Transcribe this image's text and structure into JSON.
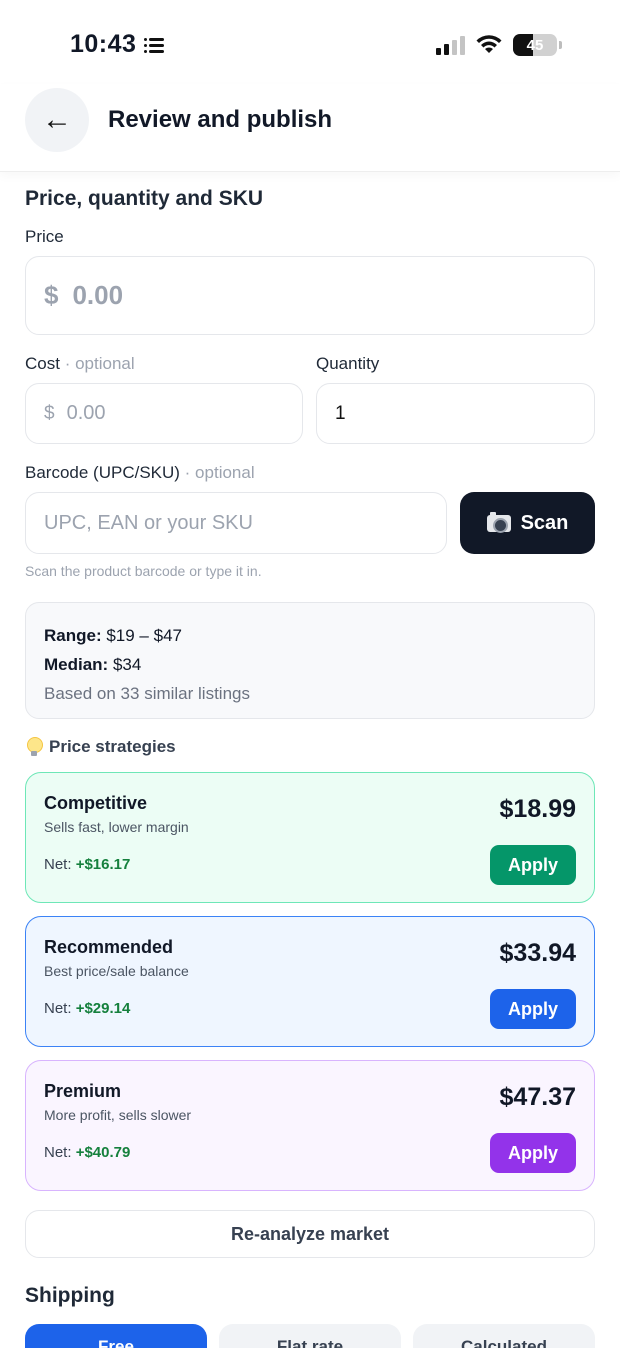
{
  "status_bar": {
    "time": "10:43",
    "battery": "45",
    "battery_level": 0.45
  },
  "header": {
    "back_icon": "←",
    "title": "Review and publish"
  },
  "pricing": {
    "section_title": "Price, quantity and SKU",
    "price_label": "Price",
    "price_currency": "$",
    "price_placeholder": "0.00",
    "cost_label": "Cost",
    "cost_optional": "· optional",
    "cost_currency": "$",
    "cost_placeholder": "0.00",
    "quantity_label": "Quantity",
    "quantity_value": "1",
    "barcode_label": "Barcode (UPC/SKU)",
    "barcode_optional": "· optional",
    "barcode_placeholder": "UPC, EAN or your SKU",
    "scan_label": "Scan",
    "helper": "Scan the product barcode or type it in."
  },
  "market": {
    "range_label": "Range:",
    "range_value": " $19 – $47",
    "median_label": "Median:",
    "median_value": " $34",
    "note": "Based on 33 similar listings"
  },
  "strategies": {
    "title": "Price strategies",
    "items": [
      {
        "name": "Competitive",
        "desc": "Sells fast, lower margin",
        "price": "$18.99",
        "net_label": "Net: ",
        "net_value": "+$16.17",
        "apply": "Apply"
      },
      {
        "name": "Recommended",
        "desc": "Best price/sale balance",
        "price": "$33.94",
        "net_label": "Net: ",
        "net_value": "+$29.14",
        "apply": "Apply"
      },
      {
        "name": "Premium",
        "desc": "More profit, sells slower",
        "price": "$47.37",
        "net_label": "Net: ",
        "net_value": "+$40.79",
        "apply": "Apply"
      }
    ],
    "reanalyze": "Re-analyze market"
  },
  "shipping": {
    "title": "Shipping",
    "tabs": [
      {
        "label": "Free"
      },
      {
        "label": "Flat rate"
      },
      {
        "label": "Calculated"
      }
    ]
  },
  "colors": {
    "competitive_accent": "#059669",
    "recommended_accent": "#1d63ea",
    "premium_accent": "#9333ea",
    "net_positive": "#15803d"
  }
}
